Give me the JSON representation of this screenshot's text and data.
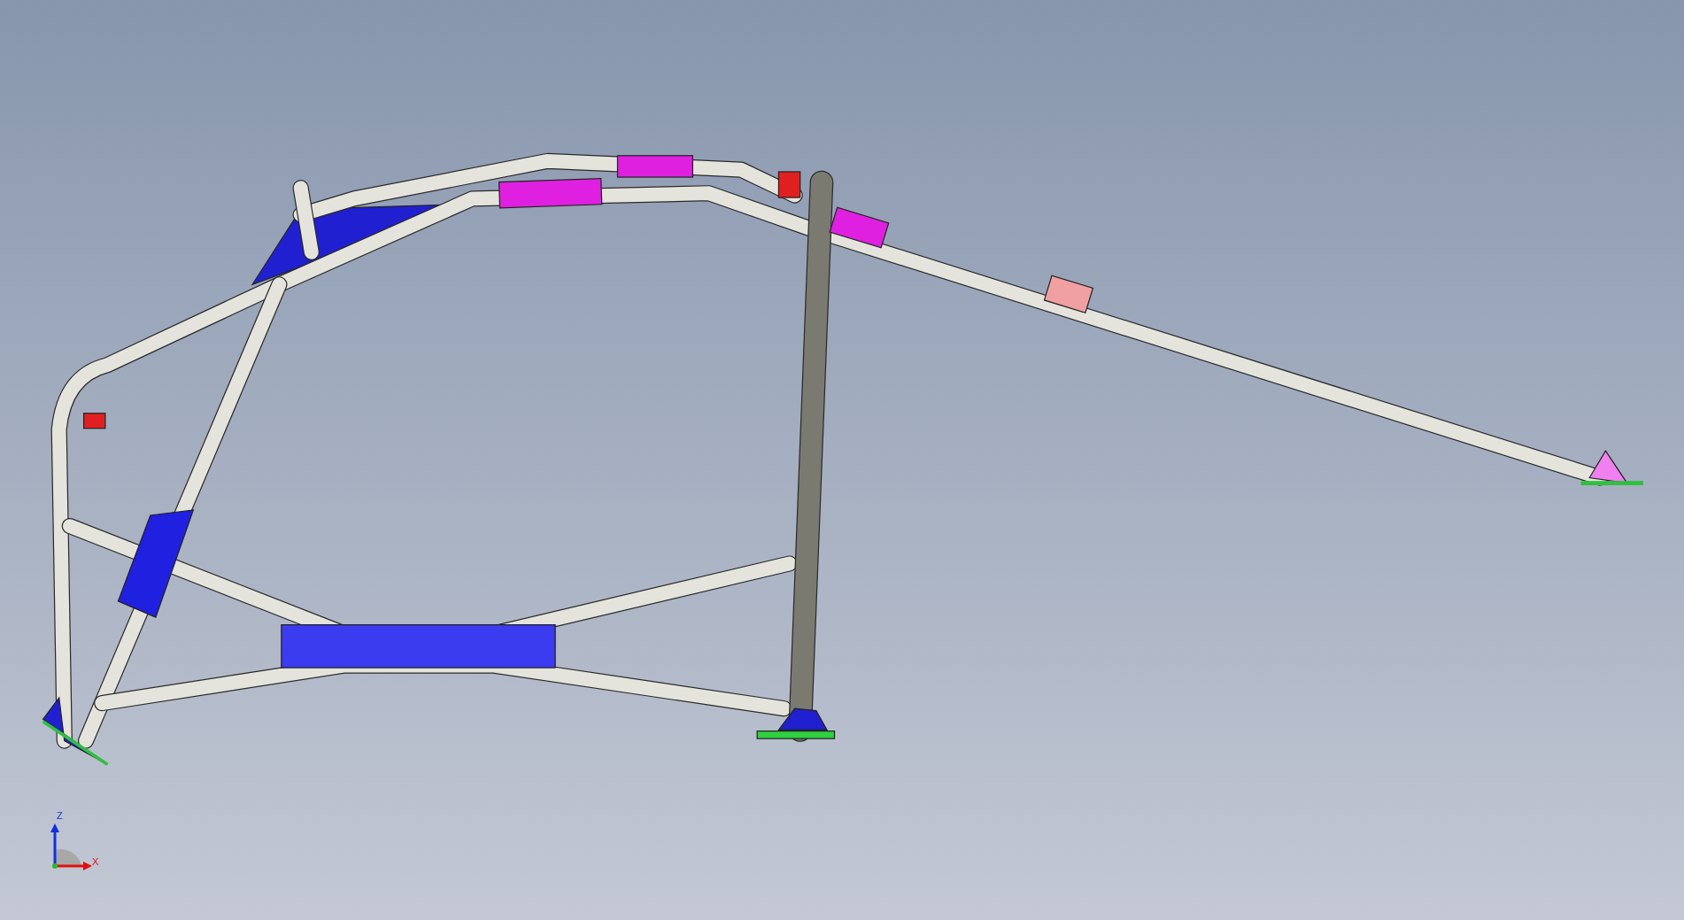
{
  "viewport": {
    "axis_triad": {
      "z_label": "Z",
      "x_label": "X"
    }
  }
}
